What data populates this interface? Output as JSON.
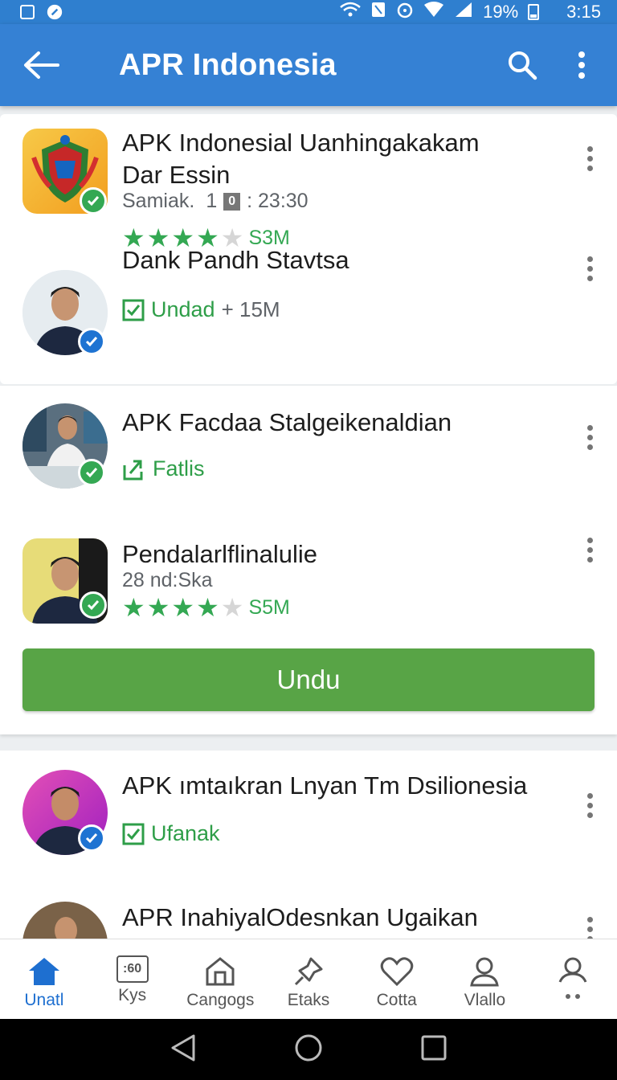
{
  "status_bar": {
    "battery": "19%",
    "time": "3:15"
  },
  "app_bar": {
    "title": "APR Indonesia"
  },
  "items": [
    {
      "title_line1": "APK Indonesial Uanhingakakam",
      "title_line2": "Dar Essin",
      "meta_left": "Samiak.",
      "meta_num": "1",
      "meta_box": "0",
      "meta_right": ": 23:30",
      "stars": 4,
      "rating_text": "S3M"
    },
    {
      "title": "Dank Pandh Stavtsa",
      "status": "Undad",
      "extra": "+ 15M"
    },
    {
      "title": "APK Facdaa Stalgeikenaldian",
      "status": "Fatlis"
    },
    {
      "title": "Pendalarlflinalulie",
      "meta": "28 nd:Ska",
      "stars": 4,
      "rating_text": "S5M"
    },
    {
      "title": "APK ımtaıkran Lnyan Tm Dsilionesia",
      "status": "Ufanak"
    },
    {
      "title": "APR InahiyalOdesnkan Ugaikan"
    }
  ],
  "primary_button": {
    "label": "Undu"
  },
  "bottom_nav": [
    {
      "label": "Unatl",
      "active": true
    },
    {
      "label": "Kys",
      "icon_text": ":60"
    },
    {
      "label": "Cangogs"
    },
    {
      "label": "Etaks"
    },
    {
      "label": "Cotta"
    },
    {
      "label": "Vlallo"
    },
    {
      "label": ""
    }
  ],
  "colors": {
    "app_bar": "#3581d4",
    "accent_green": "#34a853",
    "button_green": "#58a446",
    "active_blue": "#1e6fd0"
  }
}
